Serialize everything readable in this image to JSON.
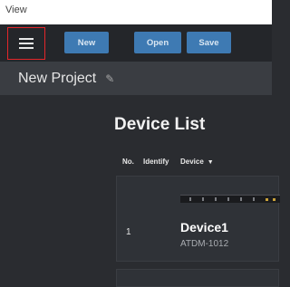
{
  "menubar": {
    "label": "View"
  },
  "toolbar": {
    "new_label": "New",
    "open_label": "Open",
    "save_label": "Save"
  },
  "project": {
    "title": "New Project"
  },
  "device_list": {
    "title": "Device List",
    "columns": [
      "No.",
      "Identify",
      "Device"
    ],
    "rows": [
      {
        "no": "1",
        "name": "Device1",
        "model": "ATDM-1012"
      }
    ]
  },
  "colors": {
    "background": "#2a2c30",
    "toolbar": "#24262a",
    "subheader": "#3a3d42",
    "button": "#3e7ab3",
    "highlight": "#e3262a"
  },
  "icons": {
    "menu": "hamburger-icon",
    "edit": "pencil-icon",
    "sort": "caret-down-icon"
  }
}
